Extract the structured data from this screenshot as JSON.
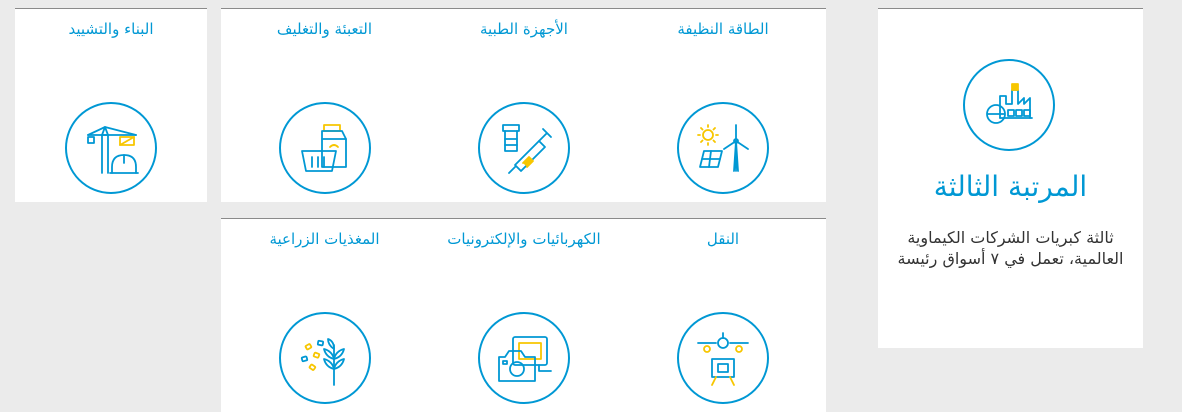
{
  "colors": {
    "accent": "#0098d4",
    "highlight": "#f7c600",
    "background": "#ebebeb",
    "card": "#ffffff"
  },
  "rank": {
    "icon": "chemical-plant-icon",
    "heading": "المرتبة الثالثة",
    "description": "ثالثة كبريات الشركات الكيماوية العالمية، تعمل في ٧ أسواق رئيسة"
  },
  "markets": [
    {
      "label": "الطاقة النظيفة",
      "icon": "solar-wind-energy-icon"
    },
    {
      "label": "الأجهزة الطبية",
      "icon": "syringe-vial-icon"
    },
    {
      "label": "التعبئة والتغليف",
      "icon": "carton-basket-icon"
    },
    {
      "label": "البناء والتشييد",
      "icon": "crane-helmet-icon"
    },
    {
      "label": "النقل",
      "icon": "car-drone-icon"
    },
    {
      "label": "الكهربائيات والإلكترونيات",
      "icon": "camera-screen-icon"
    },
    {
      "label": "المغذيات الزراعية",
      "icon": "wheat-seeds-icon"
    }
  ]
}
